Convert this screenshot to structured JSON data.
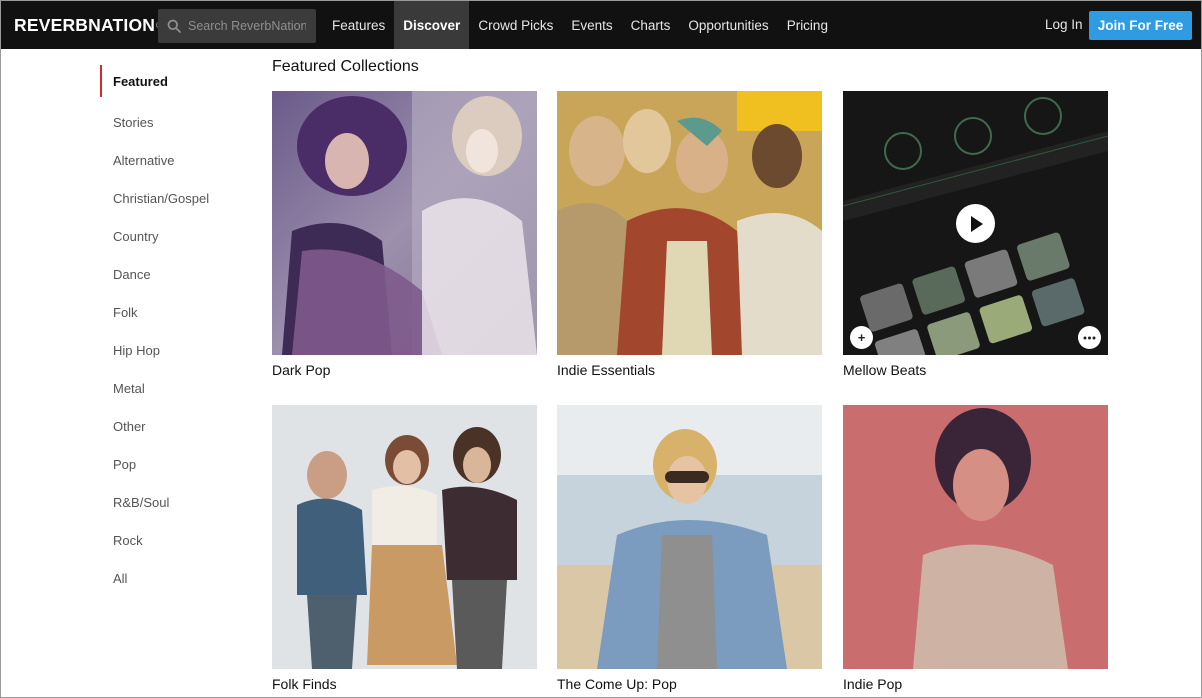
{
  "header": {
    "logo_text": "REVERBNATION",
    "logo_mark": "®",
    "search_placeholder": "Search ReverbNation",
    "nav": [
      "Features",
      "Discover",
      "Crowd Picks",
      "Events",
      "Charts",
      "Opportunities",
      "Pricing"
    ],
    "active_nav": "Discover",
    "login_label": "Log In",
    "join_label": "Join For Free",
    "accent_color": "#2f9be3",
    "brand_color": "#d6282c"
  },
  "sidebar": {
    "items": [
      "Featured",
      "Stories",
      "Alternative",
      "Christian/Gospel",
      "Country",
      "Dance",
      "Folk",
      "Hip Hop",
      "Metal",
      "Other",
      "Pop",
      "R&B/Soul",
      "Rock",
      "All"
    ],
    "active": "Featured"
  },
  "main": {
    "section_title": "Featured Collections",
    "collections": [
      {
        "title": "Dark Pop"
      },
      {
        "title": "Indie Essentials"
      },
      {
        "title": "Mellow Beats"
      },
      {
        "title": "Folk Finds"
      },
      {
        "title": "The Come Up: Pop"
      },
      {
        "title": "Indie Pop"
      }
    ],
    "overlay_icons": [
      "play-icon",
      "plus-icon",
      "more-icon"
    ]
  }
}
